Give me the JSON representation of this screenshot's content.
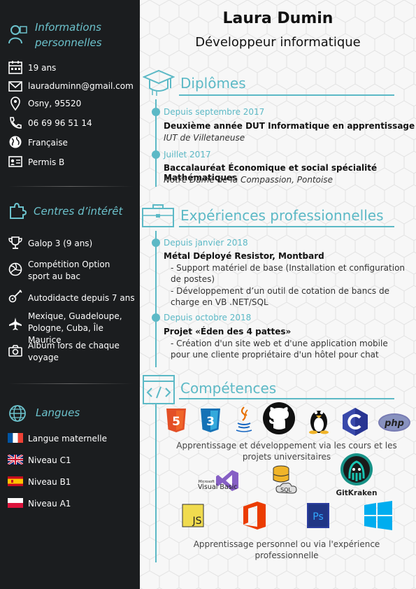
{
  "header": {
    "name": "Laura Dumin",
    "job": "Développeur informatique"
  },
  "sidebar": {
    "personal": {
      "title": "Informations personnelles",
      "items": [
        {
          "icon": "calendar-icon",
          "text": "19 ans"
        },
        {
          "icon": "envelope-icon",
          "text": "lauraduminn@gmail.com"
        },
        {
          "icon": "location-pin-icon",
          "text": "Osny, 95520"
        },
        {
          "icon": "phone-icon",
          "text": "06 69 96 51 14"
        },
        {
          "icon": "globe-icon",
          "text": "Française"
        },
        {
          "icon": "license-card-icon",
          "text": "Permis B"
        }
      ]
    },
    "interests": {
      "title": "Centres d’intérêt",
      "items": [
        {
          "icon": "trophy-icon",
          "text": "Galop 3 (9 ans)"
        },
        {
          "icon": "volleyball-icon",
          "text": "Compétition Option sport au bac"
        },
        {
          "icon": "guitar-icon",
          "text": "Autodidacte depuis 7 ans"
        },
        {
          "icon": "airplane-icon",
          "text": "Mexique, Guadeloupe, Pologne, Cuba, Île Maurice"
        },
        {
          "icon": "camera-icon",
          "text": "Album lors de chaque voyage"
        }
      ]
    },
    "languages": {
      "title": "Langues",
      "items": [
        {
          "flag": "france-flag-icon",
          "text": "Langue maternelle"
        },
        {
          "flag": "uk-flag-icon",
          "text": "Niveau C1"
        },
        {
          "flag": "spain-flag-icon",
          "text": "Niveau B1"
        },
        {
          "flag": "poland-flag-icon",
          "text": "Niveau A1"
        }
      ]
    }
  },
  "diplomas": {
    "title": "Diplômes",
    "entries": [
      {
        "date": "Depuis septembre 2017",
        "title": "Deuxième année DUT Informatique en apprentissage",
        "place": "IUT de Villetaneuse"
      },
      {
        "date": "Juillet 2017",
        "title": "Baccalauréat Économique et social spécialité Mathématiques",
        "place": "Notre Dame de la Compassion, Pontoise"
      }
    ]
  },
  "experiences": {
    "title": "Expériences professionnelles",
    "entries": [
      {
        "date": "Depuis janvier 2018",
        "title": "Métal Déployé Resistor, Montbard",
        "bullets": [
          "- Support matériel de base (Installation et configuration de postes)",
          "- Développement d’un outil de cotation de bancs de charge en VB .NET/SQL"
        ]
      },
      {
        "date": "Depuis octobre 2018",
        "title": "Projet «Éden des 4 pattes»",
        "bullets": [
          "- Création d'un site web et d'une application mobile pour une cliente propriétaire d'un hôtel pour chat"
        ]
      }
    ]
  },
  "skills": {
    "title": "Compétences",
    "logos_row1": [
      "HTML5",
      "CSS3",
      "Java",
      "GitHub",
      "Linux",
      "C",
      "PHP"
    ],
    "note1": "Apprentissage et développement via les cours et les projets universitaires",
    "logos_row2": {
      "vb_small": "Microsoft",
      "vb": "Visual Basic",
      "sql": "SQL",
      "gitkraken": "GitKraken"
    },
    "logos_row3": {
      "js": "JS",
      "ps": "Ps"
    },
    "note2": "Apprentissage personnel ou via l'expérience professionnelle",
    "logo_colors": {
      "html5": "#e34f26",
      "css3": "#1572b6",
      "java": "#e76f00",
      "c": "#3949ab",
      "php": "#777bb3",
      "office": "#eb3c00",
      "ps": "#2c3e9f",
      "windows": "#00adef",
      "js": "#f0db4f",
      "accent": "#5cb9c6"
    }
  }
}
